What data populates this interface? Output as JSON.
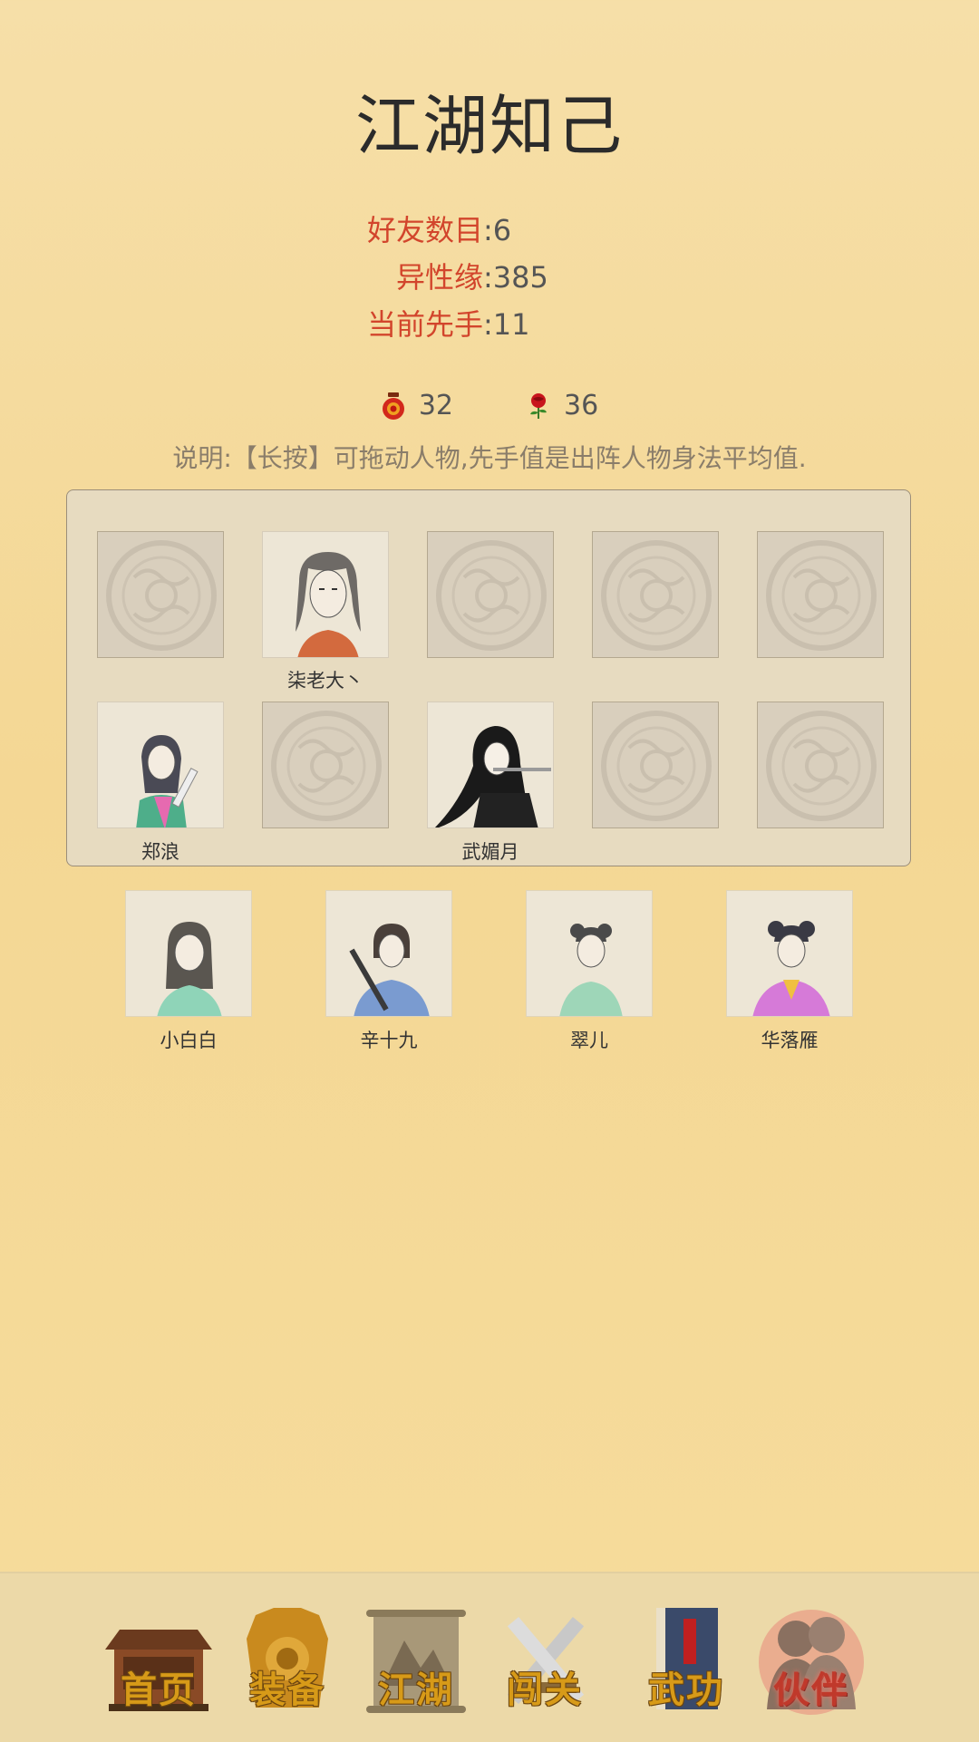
{
  "header": {
    "title": "江湖知己"
  },
  "stats": [
    {
      "label": "好友数目",
      "value": "6"
    },
    {
      "label": "异性缘",
      "value": "385"
    },
    {
      "label": "当前先手",
      "value": "11"
    }
  ],
  "stat_separator": ":",
  "resources": {
    "wine": {
      "icon": "wine-jar-icon",
      "value": "32"
    },
    "rose": {
      "icon": "rose-icon",
      "value": "36"
    }
  },
  "note": "说明:【长按】可拖动人物,先手值是出阵人物身法平均值.",
  "team_slots": [
    {
      "name": ""
    },
    {
      "name": "柒老大丶"
    },
    {
      "name": ""
    },
    {
      "name": ""
    },
    {
      "name": ""
    },
    {
      "name": "郑浪"
    },
    {
      "name": ""
    },
    {
      "name": "武媚月"
    },
    {
      "name": ""
    },
    {
      "name": ""
    }
  ],
  "bench": [
    {
      "name": "小白白"
    },
    {
      "name": "辛十九"
    },
    {
      "name": "翠儿"
    },
    {
      "name": "华落雁"
    }
  ],
  "nav": [
    {
      "label": "首页",
      "icon": "house-icon"
    },
    {
      "label": "装备",
      "icon": "armor-icon"
    },
    {
      "label": "江湖",
      "icon": "scroll-map-icon"
    },
    {
      "label": "闯关",
      "icon": "crossed-swords-icon"
    },
    {
      "label": "武功",
      "icon": "book-icon"
    },
    {
      "label": "伙伴",
      "icon": "companions-icon",
      "active": true
    }
  ],
  "colors": {
    "accent": "#d2452c",
    "background": "#f5d99b",
    "panel": "#e7dbc0",
    "nav_label": "#d79a18"
  }
}
